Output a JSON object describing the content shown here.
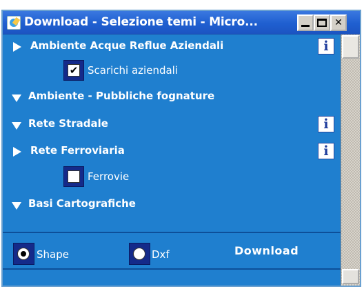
{
  "window": {
    "title": "Download - Selezione temi - Micro..."
  },
  "themes": [
    {
      "label": "Ambiente Acque Reflue Aziendali",
      "expanded": false,
      "has_info": true
    },
    {
      "label": "Ambiente - Pubbliche fognature",
      "expanded": true,
      "has_info": false
    },
    {
      "label": "Rete Stradale",
      "expanded": true,
      "has_info": true
    },
    {
      "label": "Rete Ferroviaria",
      "expanded": false,
      "has_info": true
    },
    {
      "label": "Basi Cartografiche",
      "expanded": true,
      "has_info": false
    }
  ],
  "layers": [
    {
      "label": "Scarichi aziendali",
      "checked": true
    },
    {
      "label": "Ferrovie",
      "checked": false
    }
  ],
  "info_glyph": "i",
  "format": {
    "options": [
      "Shape",
      "Dxf"
    ],
    "selected": "Shape"
  },
  "download_label": "Download",
  "colors": {
    "panel_bg": "#1f7fcf",
    "titlebar": "#1f5fd0",
    "frame": "#142a8a"
  }
}
